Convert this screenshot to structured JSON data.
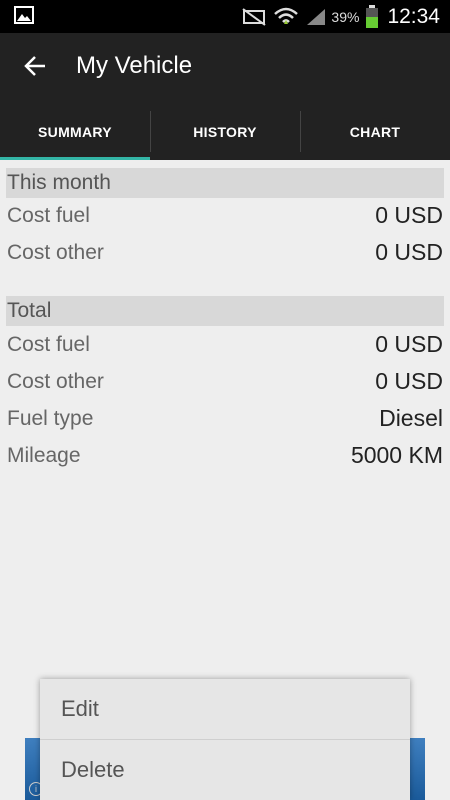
{
  "status_bar": {
    "battery_percent": "39%",
    "time": "12:34",
    "icons": [
      "image-icon",
      "mute-icon",
      "wifi-icon",
      "signal-icon",
      "battery-icon"
    ]
  },
  "action_bar": {
    "title": "My Vehicle",
    "back_icon": "arrow-left-icon"
  },
  "tabs": [
    {
      "label": "SUMMARY",
      "active": true
    },
    {
      "label": "HISTORY",
      "active": false
    },
    {
      "label": "CHART",
      "active": false
    }
  ],
  "this_month": {
    "header": "This month",
    "rows": [
      {
        "label": "Cost fuel",
        "value": "0 USD"
      },
      {
        "label": "Cost other",
        "value": "0 USD"
      }
    ]
  },
  "total": {
    "header": "Total",
    "rows": [
      {
        "label": "Cost fuel",
        "value": "0 USD"
      },
      {
        "label": "Cost other",
        "value": "0 USD"
      },
      {
        "label": "Fuel type",
        "value": "Diesel"
      },
      {
        "label": "Mileage",
        "value": "5000 KM"
      }
    ]
  },
  "context_menu": {
    "items": [
      {
        "label": "Edit"
      },
      {
        "label": "Delete"
      }
    ]
  },
  "colors": {
    "action_bar_bg": "#222222",
    "tab_indicator": "#33b5a6",
    "section_header_bg": "#d8d8d8",
    "background": "#eeeeee"
  }
}
